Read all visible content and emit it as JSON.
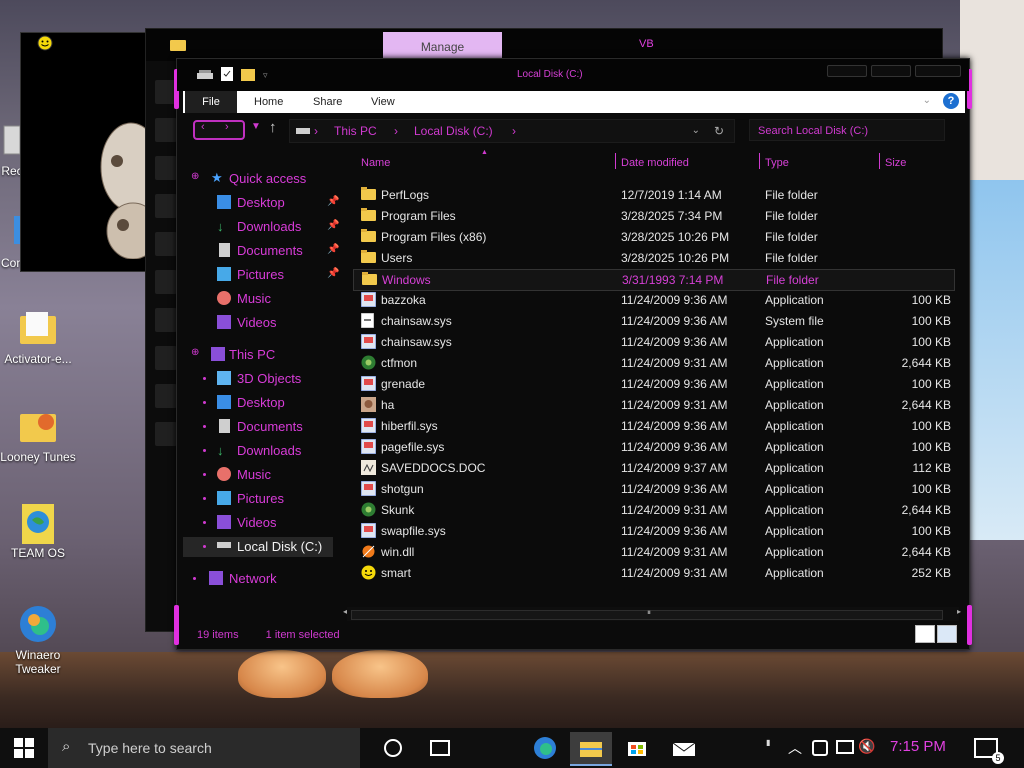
{
  "desktop": {
    "icons": [
      {
        "label": "Rec",
        "color": "#d8d8d8"
      },
      {
        "label": "Con",
        "color": "#3c8ee0"
      },
      {
        "label": "Activator-e...",
        "color": "#f2c94c"
      },
      {
        "label": "Looney Tunes",
        "color": "#f2c94c"
      },
      {
        "label": "TEAM OS",
        "color": "#f0d64a"
      },
      {
        "label": "Winaero Tweaker",
        "color": "#2d7fd6"
      }
    ]
  },
  "back_window": {
    "manage_tab": "Manage",
    "title": "VB"
  },
  "window": {
    "title": "Local Disk (C:)",
    "ribbon": {
      "tabs": [
        "File",
        "Home",
        "Share",
        "View"
      ],
      "help": "?"
    },
    "address": {
      "parts": [
        "This PC",
        "Local Disk (C:)"
      ]
    },
    "search_placeholder": "Search Local Disk (C:)",
    "nav": {
      "quick_access": "Quick access",
      "quick_items": [
        "Desktop",
        "Downloads",
        "Documents",
        "Pictures",
        "Music",
        "Videos"
      ],
      "this_pc": "This PC",
      "pc_items": [
        "3D Objects",
        "Desktop",
        "Documents",
        "Downloads",
        "Music",
        "Pictures",
        "Videos",
        "Local Disk (C:)"
      ],
      "network": "Network"
    },
    "columns": [
      "Name",
      "Date modified",
      "Type",
      "Size"
    ],
    "files": [
      {
        "name": "PerfLogs",
        "date": "12/7/2019 1:14 AM",
        "type": "File folder",
        "size": "",
        "icon": "folder"
      },
      {
        "name": "Program Files",
        "date": "3/28/2025 7:34 PM",
        "type": "File folder",
        "size": "",
        "icon": "folder"
      },
      {
        "name": "Program Files (x86)",
        "date": "3/28/2025 10:26 PM",
        "type": "File folder",
        "size": "",
        "icon": "folder"
      },
      {
        "name": "Users",
        "date": "3/28/2025 10:26 PM",
        "type": "File folder",
        "size": "",
        "icon": "folder"
      },
      {
        "name": "Windows",
        "date": "3/31/1993 7:14 PM",
        "type": "File folder",
        "size": "",
        "icon": "folder"
      },
      {
        "name": "bazzoka",
        "date": "11/24/2009 9:36 AM",
        "type": "Application",
        "size": "100 KB",
        "icon": "app"
      },
      {
        "name": "chainsaw.sys",
        "date": "11/24/2009 9:36 AM",
        "type": "System file",
        "size": "100 KB",
        "icon": "sys"
      },
      {
        "name": "chainsaw.sys",
        "date": "11/24/2009 9:36 AM",
        "type": "Application",
        "size": "100 KB",
        "icon": "app"
      },
      {
        "name": "ctfmon",
        "date": "11/24/2009 9:31 AM",
        "type": "Application",
        "size": "2,644 KB",
        "icon": "green"
      },
      {
        "name": "grenade",
        "date": "11/24/2009 9:36 AM",
        "type": "Application",
        "size": "100 KB",
        "icon": "app"
      },
      {
        "name": "ha",
        "date": "11/24/2009 9:31 AM",
        "type": "Application",
        "size": "2,644 KB",
        "icon": "face"
      },
      {
        "name": "hiberfil.sys",
        "date": "11/24/2009 9:36 AM",
        "type": "Application",
        "size": "100 KB",
        "icon": "app"
      },
      {
        "name": "pagefile.sys",
        "date": "11/24/2009 9:36 AM",
        "type": "Application",
        "size": "100 KB",
        "icon": "app"
      },
      {
        "name": "SAVEDDOCS.DOC",
        "date": "11/24/2009 9:37 AM",
        "type": "Application",
        "size": "112 KB",
        "icon": "doc"
      },
      {
        "name": "shotgun",
        "date": "11/24/2009 9:36 AM",
        "type": "Application",
        "size": "100 KB",
        "icon": "app"
      },
      {
        "name": "Skunk",
        "date": "11/24/2009 9:31 AM",
        "type": "Application",
        "size": "2,644 KB",
        "icon": "green"
      },
      {
        "name": "swapfile.sys",
        "date": "11/24/2009 9:36 AM",
        "type": "Application",
        "size": "100 KB",
        "icon": "app"
      },
      {
        "name": "win.dll",
        "date": "11/24/2009 9:31 AM",
        "type": "Application",
        "size": "2,644 KB",
        "icon": "orange"
      },
      {
        "name": "smart",
        "date": "11/24/2009 9:31 AM",
        "type": "Application",
        "size": "252 KB",
        "icon": "smiley"
      }
    ],
    "status": {
      "count": "19 items",
      "selected": "1 item selected"
    }
  },
  "taskbar": {
    "search_placeholder": "Type here to search",
    "time": "7:15 PM",
    "notification_count": "5"
  },
  "colors": {
    "accent": "#d640d6",
    "background": "#0b0b0b"
  }
}
